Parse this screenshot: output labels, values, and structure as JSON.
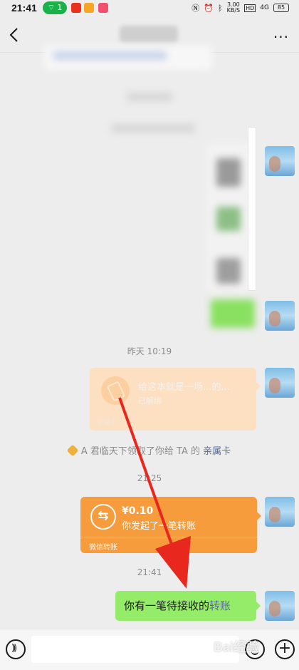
{
  "status_bar": {
    "time": "21:41",
    "wifi_badge": "1",
    "network_speed": "3.00",
    "network_unit": "KB/S",
    "hd_label": "HD",
    "signal": "4G",
    "battery": "85"
  },
  "header": {
    "back_icon": "chevron-left-icon",
    "more_icon": "more-dots-icon",
    "more_label": "···"
  },
  "chat": {
    "time_yesterday": "昨天 10:19",
    "family_card": {
      "title": "给这本就是一场...的...",
      "status": "已解绑",
      "footer": "亲属卡"
    },
    "system_note": {
      "text": "A 君临天下领取了你给 TA 的 ",
      "link": "亲属卡"
    },
    "time_2125": "21:25",
    "transfer": {
      "amount": "¥0.10",
      "description": "你发起了一笔转账",
      "footer": "微信转账"
    },
    "time_2141": "21:41",
    "last_message": {
      "text": "你有一笔待接收的",
      "highlight": "转账"
    }
  },
  "input_bar": {
    "voice_icon": "voice-icon",
    "emoji_icon": "emoji-icon",
    "plus_icon": "plus-icon",
    "plus_label": "+"
  },
  "watermark": "Bai经验",
  "colors": {
    "background": "#ededed",
    "green_bubble": "#95ec69",
    "transfer_orange": "#f79c3c",
    "family_card": "#fde0c2",
    "link_blue": "#576b95",
    "annotation_red": "#e8281e"
  }
}
